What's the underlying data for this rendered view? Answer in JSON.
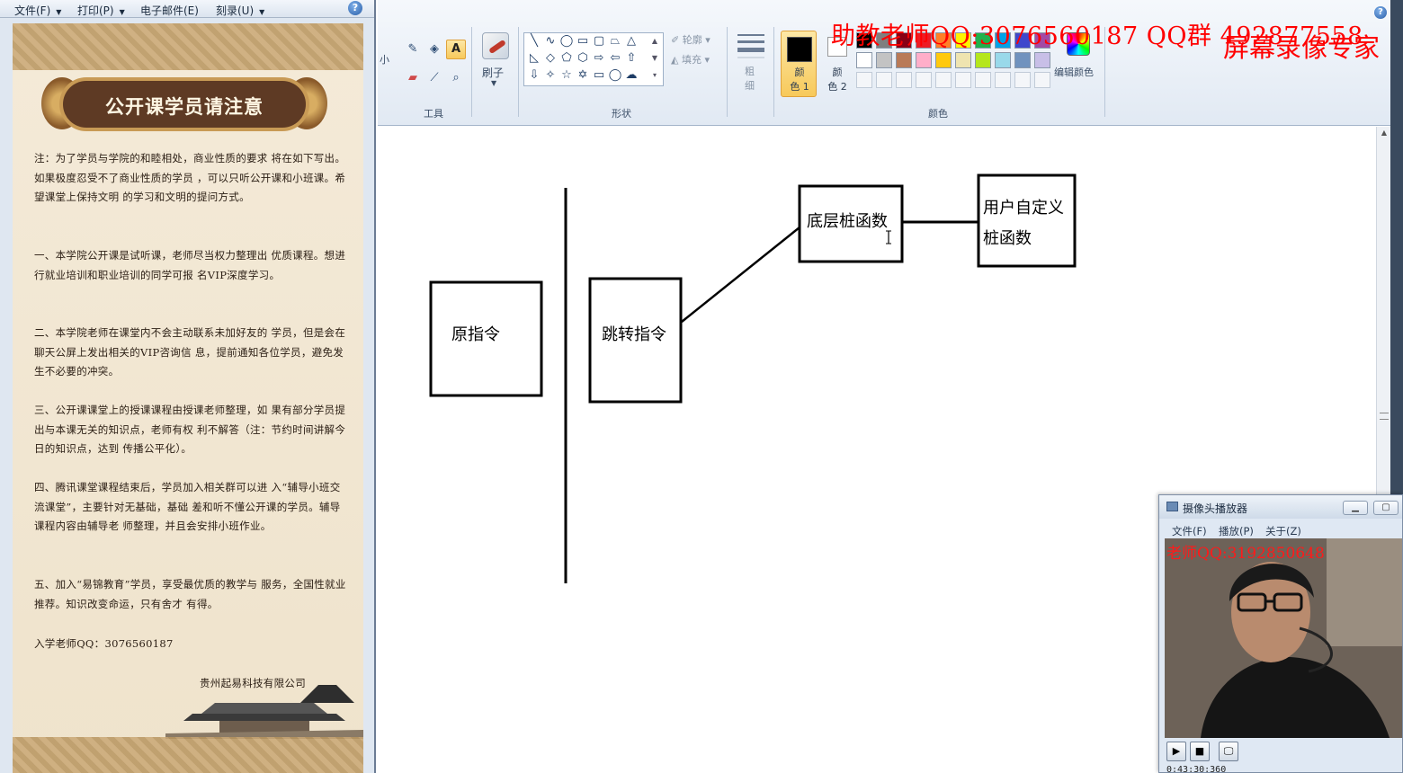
{
  "left_panel": {
    "menu": [
      {
        "label": "文件(F)"
      },
      {
        "label": "打印(P)"
      },
      {
        "label": "电子邮件(E)"
      },
      {
        "label": "刻录(U)"
      }
    ],
    "help_glyph": "?",
    "poster": {
      "title": "公开课学员请注意",
      "paragraphs": [
        "注：为了学员与学院的和睦相处，商业性质的要求 将在如下写出。如果极度忍受不了商业性质的学员 ，可以只听公开课和小班课。希望课堂上保持文明 的学习和文明的提问方式。",
        "一、本学院公开课是试听课，老师尽当权力整理出 优质课程。想进行就业培训和职业培训的同学可报 名VIP深度学习。",
        "二、本学院老师在课堂内不会主动联系未加好友的 学员，但是会在聊天公屏上发出相关的VIP咨询信 息，提前通知各位学员，避免发生不必要的冲突。",
        "三、公开课课堂上的授课课程由授课老师整理，如 果有部分学员提出与本课无关的知识点，老师有权 利不解答（注：节约时间讲解今日的知识点，达到 传播公平化）。",
        "四、腾讯课堂课程结束后，学员加入相关群可以进 入“辅导小班交流课堂”，主要针对无基础，基础 差和听不懂公开课的学员。辅导课程内容由辅导老 师整理，并且会安排小班作业。",
        "五、加入“易锦教育”学员，享受最优质的教学与 服务，全国性就业推荐。知识改变命运，只有舍才 有得。"
      ],
      "contact": "入学老师QQ：3076560187",
      "company": "贵州起易科技有限公司"
    }
  },
  "ribbon": {
    "size_label": "小",
    "groups": {
      "tools": "工具",
      "shapes": "形状",
      "colors": "颜色"
    },
    "brush_label": "刷子",
    "outline_label": "轮廓",
    "fill_label": "填充",
    "thickness_label": "粗\n细",
    "color1": {
      "line1": "颜",
      "line2": "色 1",
      "value": "#000000"
    },
    "color2": {
      "line1": "颜",
      "line2": "色 2",
      "value": "#ffffff"
    },
    "edit_colors_label": "编辑颜色",
    "palette_row1": [
      "#000000",
      "#7f7f7f",
      "#880015",
      "#ed1c24",
      "#ff7f27",
      "#fff200",
      "#22b14c",
      "#00a2e8",
      "#3f48cc",
      "#a349a4"
    ],
    "palette_row2": [
      "#ffffff",
      "#c3c3c3",
      "#b97a57",
      "#ffaec9",
      "#ffc90e",
      "#efe4b0",
      "#b5e61d",
      "#99d9ea",
      "#7092be",
      "#c8bfe7"
    ],
    "help_glyph": "?"
  },
  "watermarks": {
    "top": "助教老师QQ:3076560187  QQ群 492877558",
    "brand": "屏幕录像专家"
  },
  "diagram": {
    "box_original": "原指令",
    "box_jump": "跳转指令",
    "box_bottom_stub": "底层桩函数",
    "box_user_stub_line1": "用户自定义",
    "box_user_stub_line2": "桩函数"
  },
  "camera_window": {
    "title": "摄像头播放器",
    "menu": [
      "文件(F)",
      "播放(P)",
      "关于(Z)"
    ],
    "video_watermark": "老师QQ:3192850648",
    "time": "0:43:30:360"
  }
}
